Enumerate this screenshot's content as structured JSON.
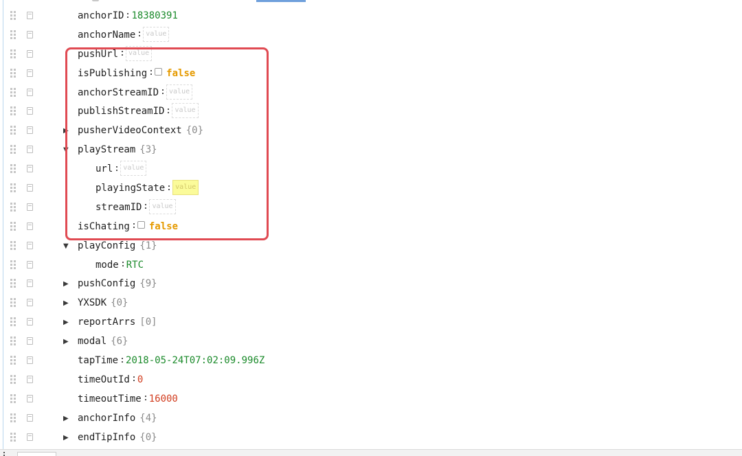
{
  "rows": [
    {
      "key": "anchorID",
      "type": "value",
      "value": "18380391",
      "color": "#1a8a2a",
      "indent": 0
    },
    {
      "key": "anchorName",
      "type": "placeholder",
      "placeholder": "value",
      "indent": 0
    },
    {
      "key": "pushUrl",
      "type": "placeholder",
      "placeholder": "value",
      "indent": 0
    },
    {
      "key": "isPublishing",
      "type": "boolean",
      "value": "false",
      "indent": 0
    },
    {
      "key": "anchorStreamID",
      "type": "placeholder",
      "placeholder": "value",
      "indent": 0
    },
    {
      "key": "publishStreamID",
      "type": "placeholder",
      "placeholder": "value",
      "indent": 0
    },
    {
      "key": "pusherVideoContext",
      "type": "object",
      "count": "{0}",
      "expanded": false,
      "indent": 0
    },
    {
      "key": "playStream",
      "type": "object",
      "count": "{3}",
      "expanded": true,
      "indent": 0
    },
    {
      "key": "url",
      "type": "placeholder",
      "placeholder": "value",
      "indent": 1
    },
    {
      "key": "playingState",
      "type": "placeholder",
      "placeholder": "value",
      "highlighted": true,
      "indent": 1
    },
    {
      "key": "streamID",
      "type": "placeholder",
      "placeholder": "value",
      "indent": 1
    },
    {
      "key": "isChating",
      "type": "boolean",
      "value": "false",
      "indent": 0
    },
    {
      "key": "playConfig",
      "type": "object",
      "count": "{1}",
      "expanded": true,
      "indent": 0
    },
    {
      "key": "mode",
      "type": "value",
      "value": "RTC",
      "color": "#1a8a2a",
      "indent": 1
    },
    {
      "key": "pushConfig",
      "type": "object",
      "count": "{9}",
      "expanded": false,
      "indent": 0
    },
    {
      "key": "YXSDK",
      "type": "object",
      "count": "{0}",
      "expanded": false,
      "indent": 0
    },
    {
      "key": "reportArrs",
      "type": "object",
      "count": "[0]",
      "expanded": false,
      "indent": 0
    },
    {
      "key": "modal",
      "type": "object",
      "count": "{6}",
      "expanded": false,
      "indent": 0
    },
    {
      "key": "tapTime",
      "type": "value",
      "value": "2018-05-24T07:02:09.996Z",
      "color": "#1a8a2a",
      "indent": 0
    },
    {
      "key": "timeOutId",
      "type": "value",
      "value": "0",
      "color": "#d23d1f",
      "indent": 0
    },
    {
      "key": "timeoutTime",
      "type": "value",
      "value": "16000",
      "color": "#d23d1f",
      "indent": 0
    },
    {
      "key": "anchorInfo",
      "type": "object",
      "count": "{4}",
      "expanded": false,
      "indent": 0
    },
    {
      "key": "endTipInfo",
      "type": "object",
      "count": "{0}",
      "expanded": false,
      "indent": 0
    }
  ],
  "colors": {
    "string": "#1a8a2a",
    "number": "#d23d1f",
    "boolean": "#e59a00",
    "highlight_box": "#e04a52"
  }
}
